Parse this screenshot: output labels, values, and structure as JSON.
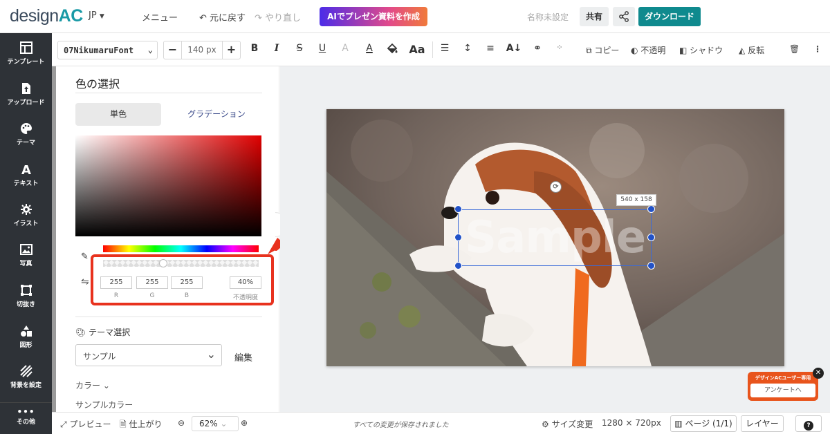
{
  "header": {
    "logo_main": "design",
    "logo_accent": "AC",
    "language": "JP",
    "menu": "メニュー",
    "undo": "元に戻す",
    "redo": "やり直し",
    "ai_button": "AIでプレゼン資料を作成",
    "doc_name": "名称未設定",
    "share": "共有",
    "download": "ダウンロード"
  },
  "sidebar": {
    "items": [
      {
        "label": "テンプレート",
        "icon": "template-icon"
      },
      {
        "label": "アップロード",
        "icon": "upload-icon"
      },
      {
        "label": "テーマ",
        "icon": "palette-icon"
      },
      {
        "label": "テキスト",
        "icon": "text-icon"
      },
      {
        "label": "イラスト",
        "icon": "illustration-icon"
      },
      {
        "label": "写真",
        "icon": "photo-icon"
      },
      {
        "label": "切抜き",
        "icon": "crop-icon"
      },
      {
        "label": "図形",
        "icon": "shapes-icon"
      },
      {
        "label": "背景を設定",
        "icon": "background-icon"
      },
      {
        "label": "その他",
        "icon": "more-icon"
      }
    ]
  },
  "toolbar": {
    "font": "07NikumaruFont",
    "size": "140 px",
    "copy": "コピー",
    "opacity": "不透明",
    "shadow": "シャドウ",
    "flip": "反転"
  },
  "color_panel": {
    "title": "色の選択",
    "tab_solid": "単色",
    "tab_gradient": "グラデーション",
    "r": "255",
    "g": "255",
    "b": "255",
    "opacity": "40%",
    "label_r": "R",
    "label_g": "G",
    "label_b": "B",
    "label_opacity": "不透明度",
    "theme_head": "テーマ選択",
    "theme_value": "サンプル",
    "edit": "編集",
    "color_head": "カラー",
    "sample_color": "サンプルカラー"
  },
  "canvas": {
    "selected_size": "540 x 158",
    "sample_text": "Sample"
  },
  "survey": {
    "title": "デザインACユーザー専用",
    "button": "アンケートへ"
  },
  "footer": {
    "preview": "プレビュー",
    "finish": "仕上がり",
    "zoom": "62%",
    "saved": "すべての変更が保存されました",
    "size_change": "サイズ変更",
    "dimensions": "1280 × 720px",
    "page": "ページ",
    "page_count": "(1/1)",
    "layer": "レイヤー"
  },
  "colors": {
    "accent": "#0f8a8e",
    "sidebar": "#2e3237",
    "highlight": "#e8321e",
    "selection": "#2252c8"
  }
}
